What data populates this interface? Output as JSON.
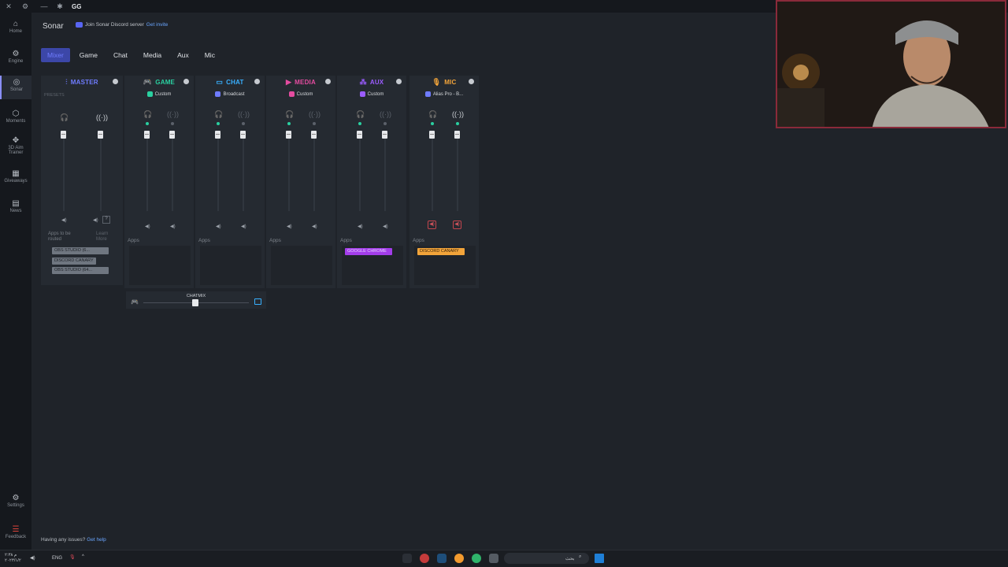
{
  "window": {
    "title": "GG",
    "close": "✕",
    "settings": "⚙",
    "minimize": "—",
    "logo_icon": "steelseries-icon"
  },
  "sidebar": {
    "items": [
      {
        "label": "Home",
        "icon": "⌂"
      },
      {
        "label": "Engine",
        "icon": "⚙"
      },
      {
        "label": "Sonar",
        "icon": "◎"
      },
      {
        "label": "Moments",
        "icon": "⬡"
      },
      {
        "label": "3D Aim Trainer",
        "icon": "✥"
      },
      {
        "label": "Giveaways",
        "icon": "▦"
      },
      {
        "label": "News",
        "icon": "▤"
      }
    ],
    "settings": {
      "label": "Settings",
      "icon": "⚙"
    },
    "feedback": {
      "label": "Feedback",
      "icon": "☰"
    }
  },
  "header": {
    "title": "Sonar",
    "discord_text": "Join Sonar Discord server",
    "discord_link": "Get invite"
  },
  "tabs": [
    "Mixer",
    "Game",
    "Chat",
    "Media",
    "Aux",
    "Mic"
  ],
  "channels": [
    {
      "name": "MASTER",
      "color": "#6f7cff",
      "icon": "⫶",
      "preset": "",
      "presets_label": "PRESETS"
    },
    {
      "name": "GAME",
      "color": "#2ad0a0",
      "icon": "🎮",
      "preset": "Custom",
      "preset_color": "#2ad0a0"
    },
    {
      "name": "CHAT",
      "color": "#38b0ff",
      "icon": "▭",
      "preset": "Broadcast",
      "preset_color": "#6f7cff"
    },
    {
      "name": "MEDIA",
      "color": "#e44ca0",
      "icon": "▶",
      "preset": "Custom",
      "preset_color": "#e44ca0"
    },
    {
      "name": "AUX",
      "color": "#9b5cff",
      "icon": "⁂",
      "preset": "Custom",
      "preset_color": "#9b5cff"
    },
    {
      "name": "MIC",
      "color": "#f2a43a",
      "icon": "🎙",
      "preset": "Alias Pro - B...",
      "preset_color": "#6f7cff"
    }
  ],
  "master": {
    "apps_note": "Apps to be routed",
    "learn_more": "Learn More",
    "apps": [
      "OBS STUDIO (6...",
      "DISCORD CANARY",
      "OBS STUDIO (64..."
    ]
  },
  "apps_label": "Apps",
  "aux_apps": [
    "GOOGLE CHROME"
  ],
  "mic_apps": [
    "DISCORD CANARY"
  ],
  "chatmix": {
    "label": "CHATMIX"
  },
  "footer": {
    "text": "Having any issues?",
    "link": "Get help"
  },
  "taskbar": {
    "lang": "ENG",
    "clock": "۲:۳۸ م",
    "date": "۲۰۲۳/۱/۲",
    "search": "بحث"
  },
  "colors": {
    "accent": "#6f7cff",
    "green": "#2ad0a0",
    "mute_red": "#c4454d"
  }
}
